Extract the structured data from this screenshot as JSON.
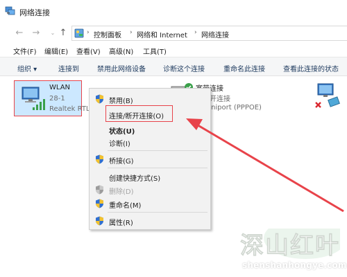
{
  "window": {
    "title": "网络连接"
  },
  "address": {
    "crumbs": [
      "控制面板",
      "网络和 Internet",
      "网络连接"
    ]
  },
  "menubar": [
    "文件(F)",
    "编辑(E)",
    "查看(V)",
    "高级(N)",
    "工具(T)"
  ],
  "commands": [
    "组织 ▾",
    "连接到",
    "禁用此网络设备",
    "诊断这个连接",
    "重命名此连接",
    "查看此连接的状态"
  ],
  "connections": {
    "wlan": {
      "name": "WLAN",
      "sub": "28-1",
      "adapter": "Realtek RTL",
      "adapter_overflow": "N Miniport (PPPOE)"
    },
    "broadband": {
      "name": "宽带连接",
      "status": "已断开连接"
    }
  },
  "context_menu": {
    "items": [
      {
        "label": "禁用(B)",
        "shield": true,
        "bold": false,
        "disabled": false
      },
      {
        "label": "连接/断开连接(O)",
        "shield": false,
        "bold": false,
        "disabled": false
      },
      {
        "label": "状态(U)",
        "shield": false,
        "bold": true,
        "disabled": false
      },
      {
        "label": "诊断(I)",
        "shield": false,
        "bold": false,
        "disabled": false
      },
      {
        "label": "桥接(G)",
        "shield": true,
        "bold": false,
        "disabled": false
      },
      {
        "label": "创建快捷方式(S)",
        "shield": false,
        "bold": false,
        "disabled": false
      },
      {
        "label": "删除(D)",
        "shield": true,
        "bold": false,
        "disabled": true
      },
      {
        "label": "重命名(M)",
        "shield": true,
        "bold": false,
        "disabled": false
      },
      {
        "label": "属性(R)",
        "shield": true,
        "bold": false,
        "disabled": false
      }
    ]
  },
  "watermark": {
    "art_text": "深山红叶",
    "url": "shenshanhongye.com"
  },
  "colors": {
    "accent_red": "#e8434a",
    "selection": "#cce8ff",
    "cmd_text": "#1e3a5e"
  }
}
